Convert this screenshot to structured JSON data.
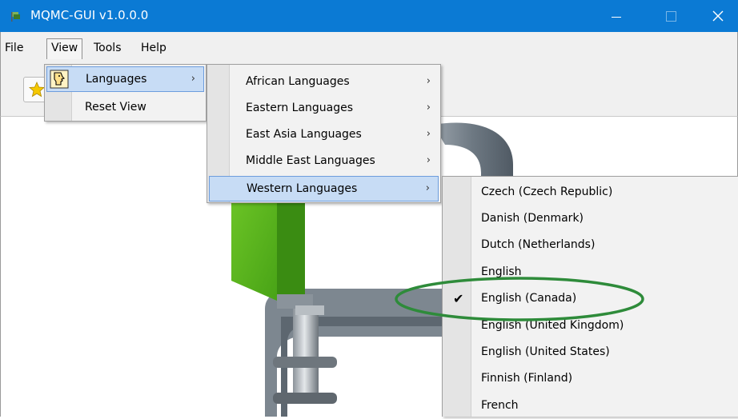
{
  "window": {
    "title": "MQMC-GUI v1.0.0.0",
    "app_icon": "app-flag-icon",
    "controls": [
      "minimize",
      "maximize",
      "close"
    ],
    "titlebar_color": "#0b7ad4"
  },
  "menubar": {
    "items": [
      {
        "label": "File"
      },
      {
        "label": "View"
      },
      {
        "label": "Tools"
      },
      {
        "label": "Help"
      }
    ]
  },
  "toolbar": {
    "buttons": [
      {
        "icon": "star-icon"
      }
    ]
  },
  "view_menu": {
    "items": [
      {
        "label": "Languages",
        "icon": "face-profile-icon",
        "has_submenu": true,
        "selected": true
      },
      {
        "label": "Reset View",
        "has_submenu": false,
        "selected": false
      }
    ]
  },
  "languages_menu": {
    "items": [
      {
        "label": "African Languages",
        "has_submenu": true
      },
      {
        "label": "Eastern Languages",
        "has_submenu": true
      },
      {
        "label": "East Asia Languages",
        "has_submenu": true
      },
      {
        "label": "Middle East Languages",
        "has_submenu": true
      },
      {
        "label": "Western Languages",
        "has_submenu": true,
        "selected": true
      }
    ]
  },
  "western_menu": {
    "items": [
      {
        "label": "Czech (Czech Republic)",
        "checked": false
      },
      {
        "label": "Danish (Denmark)",
        "checked": false
      },
      {
        "label": "Dutch (Netherlands)",
        "checked": false
      },
      {
        "label": "English",
        "checked": false
      },
      {
        "label": "English (Canada)",
        "checked": true,
        "highlighted": true
      },
      {
        "label": "English (United Kingdom)",
        "checked": false
      },
      {
        "label": "English (United States)",
        "checked": false
      },
      {
        "label": "Finnish (Finland)",
        "checked": false
      },
      {
        "label": "French",
        "checked": false
      }
    ],
    "checkmark_glyph": "✔"
  },
  "colors": {
    "selection_fill": "#c7dcf5",
    "selection_border": "#6d9ddd",
    "annotation_ellipse": "#2e8b3a",
    "cube_green": "#4fb81e"
  }
}
